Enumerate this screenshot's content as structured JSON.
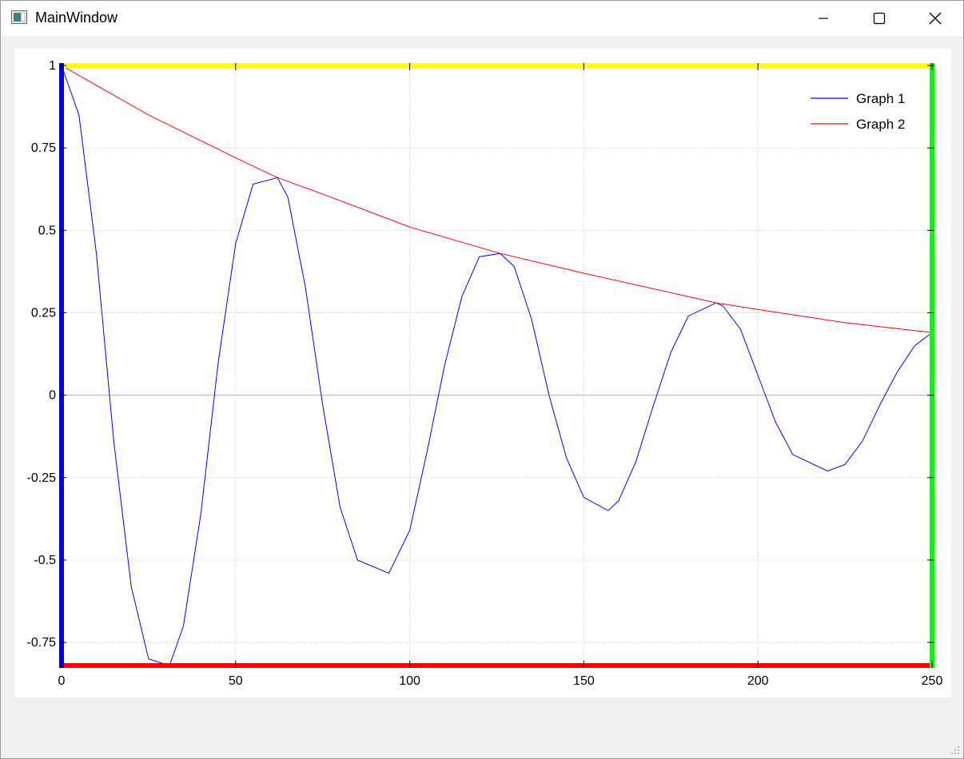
{
  "window": {
    "title": "MainWindow",
    "icon": "app-window-icon",
    "controls": [
      "minimize-icon",
      "maximize-icon",
      "close-icon"
    ]
  },
  "chart_data": {
    "type": "line",
    "title": "",
    "xlabel": "",
    "ylabel": "",
    "xlim": [
      0,
      250
    ],
    "ylim": [
      -0.82,
      1
    ],
    "xticks": [
      0,
      50,
      100,
      150,
      200,
      250
    ],
    "xtick_labels": [
      "0",
      "50",
      "100",
      "150",
      "200",
      "250"
    ],
    "yticks": [
      -0.75,
      -0.5,
      -0.25,
      0,
      0.25,
      0.5,
      0.75,
      1
    ],
    "ytick_labels": [
      "-0.75",
      "-0.5",
      "-0.25",
      "0",
      "0.25",
      "0.5",
      "0.75",
      "1"
    ],
    "grid": true,
    "legend_position": "top-right",
    "axis_colors": {
      "left": "#0000ff",
      "top": "#ffff00",
      "right": "#00ff00",
      "bottom": "#ff0000"
    },
    "series": [
      {
        "name": "Graph 1",
        "color": "#0000ff",
        "x": [
          0,
          5,
          10,
          15,
          20,
          25,
          31,
          35,
          40,
          45,
          50,
          55,
          62,
          65,
          70,
          75,
          80,
          85,
          94,
          100,
          105,
          110,
          115,
          120,
          126,
          130,
          135,
          140,
          145,
          150,
          157,
          160,
          165,
          170,
          175,
          180,
          188,
          190,
          195,
          200,
          205,
          210,
          220,
          225,
          230,
          235,
          240,
          245,
          250
        ],
        "y": [
          1,
          0.85,
          0.43,
          -0.14,
          -0.58,
          -0.8,
          -0.82,
          -0.7,
          -0.36,
          0.1,
          0.46,
          0.64,
          0.66,
          0.6,
          0.33,
          -0.03,
          -0.34,
          -0.5,
          -0.54,
          -0.41,
          -0.17,
          0.09,
          0.3,
          0.42,
          0.43,
          0.39,
          0.23,
          0.0,
          -0.19,
          -0.31,
          -0.35,
          -0.32,
          -0.2,
          -0.03,
          0.13,
          0.24,
          0.28,
          0.27,
          0.2,
          0.06,
          -0.08,
          -0.18,
          -0.23,
          -0.21,
          -0.14,
          -0.03,
          0.07,
          0.15,
          0.19
        ]
      },
      {
        "name": "Graph 2",
        "color": "#ff0000",
        "x": [
          0,
          25,
          50,
          62,
          75,
          100,
          126,
          150,
          188,
          200,
          225,
          250
        ],
        "y": [
          1,
          0.85,
          0.72,
          0.66,
          0.61,
          0.51,
          0.43,
          0.37,
          0.28,
          0.26,
          0.22,
          0.19
        ]
      }
    ]
  }
}
